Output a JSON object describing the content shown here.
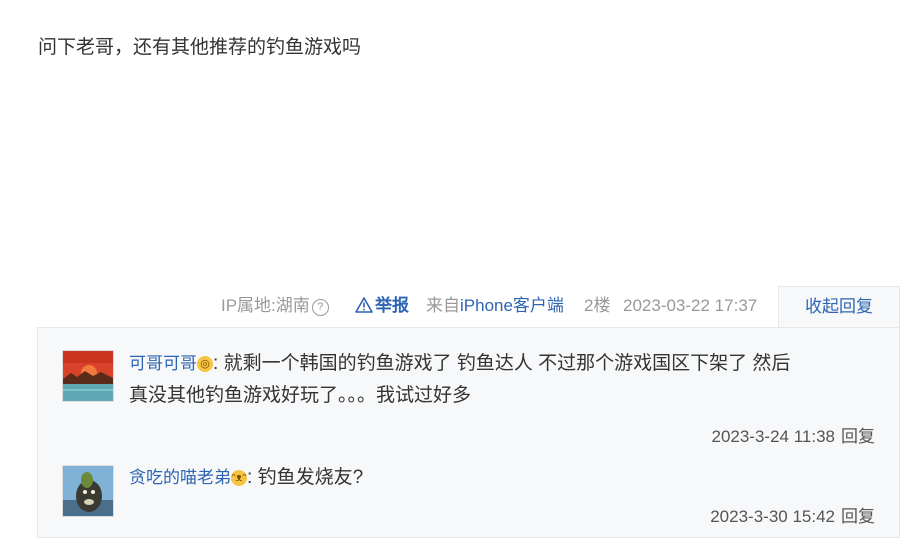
{
  "post": {
    "text": "问下老哥，还有其他推荐的钓鱼游戏吗"
  },
  "meta": {
    "ip_label": "IP属地:湖南",
    "report_label": "举报",
    "client_prefix": "来自",
    "client_name": "iPhone客户端",
    "floor": "2楼",
    "timestamp": "2023-03-22 17:37",
    "collapse_label": "收起回复"
  },
  "replies": [
    {
      "username": "可哥可哥",
      "separator": ":",
      "text_line1": "就剩一个韩国的钓鱼游戏了 钓鱼达人 不过那个游戏国区下架了 然后",
      "text_line2": "真没其他钓鱼游戏好玩了。。。我试过好多",
      "timestamp": "2023-3-24 11:38",
      "reply_label": "回复"
    },
    {
      "username": "贪吃的喵老弟",
      "separator": ":",
      "text_line1": "钓鱼发烧友?",
      "timestamp": "2023-3-30 15:42",
      "reply_label": "回复"
    }
  ],
  "colors": {
    "link": "#2d64b3",
    "muted": "#999999",
    "panel_bg": "#f7f8fa"
  }
}
